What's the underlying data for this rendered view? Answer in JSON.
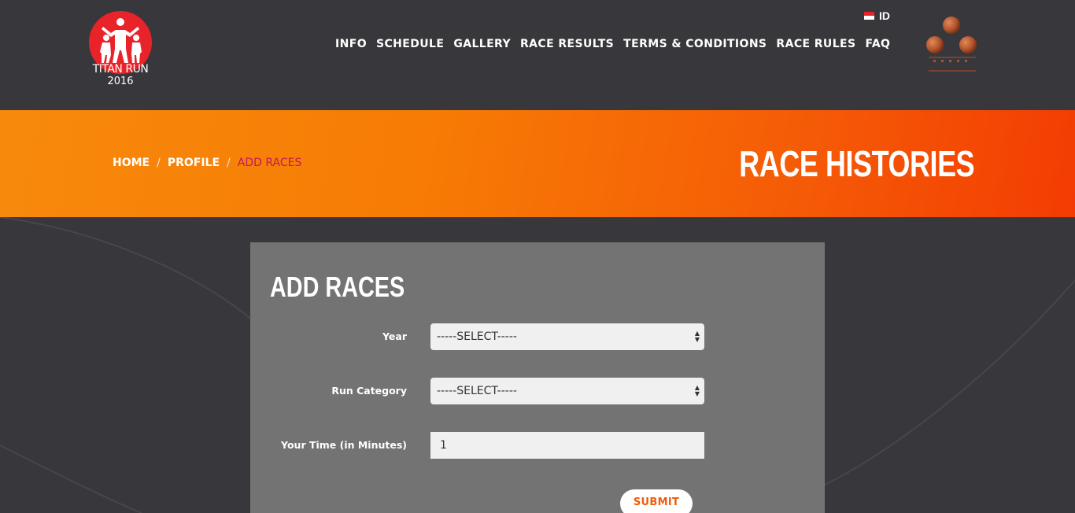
{
  "brand": {
    "logo_line1": "TITAN RUN",
    "logo_line2": "2016",
    "logo_color": "#e8232a"
  },
  "language": {
    "label": "ID",
    "flag_icon": "indonesia-flag-icon"
  },
  "nav": {
    "items": [
      {
        "label": "INFO"
      },
      {
        "label": "SCHEDULE"
      },
      {
        "label": "GALLERY"
      },
      {
        "label": "RACE RESULTS"
      },
      {
        "label": "TERMS & CONDITIONS"
      },
      {
        "label": "RACE RULES"
      },
      {
        "label": "FAQ"
      }
    ]
  },
  "banner": {
    "breadcrumb": [
      "HOME",
      "PROFILE",
      "ADD RACES"
    ],
    "separator": "/",
    "title": "RACE HISTORIES",
    "gradient_start": "#f78a0c",
    "gradient_end": "#f33c03",
    "active_crumb_color": "#c2185b"
  },
  "form": {
    "title": "ADD RACES",
    "year_label": "Year",
    "year_value": "-----SELECT-----",
    "category_label": "Run Category",
    "category_value": "-----SELECT-----",
    "time_label": "Your Time (in Minutes)",
    "time_value": "1",
    "submit_label": "SUBMIT",
    "submit_color": "#f05a0a"
  }
}
